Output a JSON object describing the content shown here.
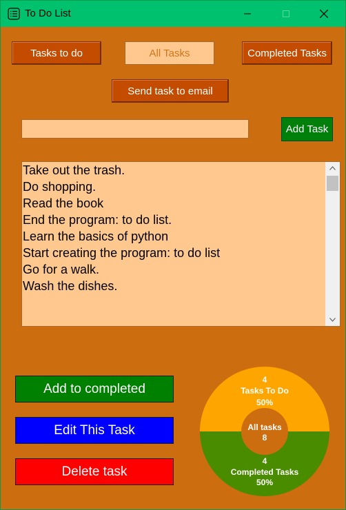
{
  "window": {
    "title": "To Do List",
    "minimize": "—",
    "maximize": "☐",
    "close": "✕"
  },
  "tabs": {
    "todo": "Tasks to do",
    "all": "All Tasks",
    "completed": "Completed Tasks"
  },
  "send_email_label": "Send task to email",
  "entry": {
    "value": ""
  },
  "add_task_label": "Add Task",
  "tasks": [
    "Take out the trash.",
    "Do shopping.",
    "Read the book",
    "End the program: to do list.",
    "Learn the basics of python",
    "Start creating the program: to do list",
    "Go for a walk.",
    "Wash the dishes."
  ],
  "scroll": {
    "up": "︿",
    "down": "﹀"
  },
  "actions": {
    "complete": "Add to completed",
    "edit": "Edit This Task",
    "delete": "Delete task"
  },
  "chart_data": {
    "type": "pie",
    "categories": [
      "Tasks To Do",
      "Completed Tasks"
    ],
    "values": [
      4,
      4
    ],
    "percents": [
      "50%",
      "50%"
    ],
    "center": {
      "label": "All tasks",
      "value": "8"
    },
    "colors": [
      "#ffa500",
      "#4a8c00"
    ],
    "center_color": "#cc6d10"
  }
}
